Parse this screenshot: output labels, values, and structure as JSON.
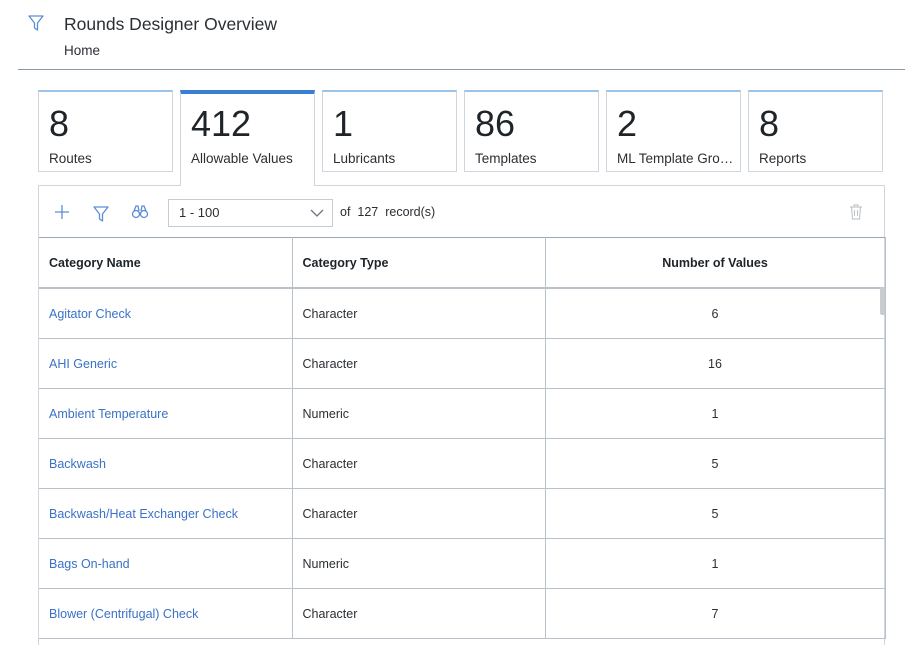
{
  "header": {
    "title": "Rounds Designer Overview",
    "breadcrumb": "Home"
  },
  "tiles": [
    {
      "count": "8",
      "label": "Routes"
    },
    {
      "count": "412",
      "label": "Allowable Values"
    },
    {
      "count": "1",
      "label": "Lubricants"
    },
    {
      "count": "86",
      "label": "Templates"
    },
    {
      "count": "2",
      "label": "ML Template Grou..."
    },
    {
      "count": "8",
      "label": "Reports"
    }
  ],
  "toolbar": {
    "range": "1 - 100",
    "of_label": "of",
    "total": "127",
    "records_label": "record(s)"
  },
  "table": {
    "columns": [
      "Category Name",
      "Category Type",
      "Number of Values"
    ],
    "rows": [
      {
        "name": "Agitator Check",
        "type": "Character",
        "count": "6"
      },
      {
        "name": "AHI Generic",
        "type": "Character",
        "count": "16"
      },
      {
        "name": "Ambient Temperature",
        "type": "Numeric",
        "count": "1"
      },
      {
        "name": "Backwash",
        "type": "Character",
        "count": "5"
      },
      {
        "name": "Backwash/Heat Exchanger Check",
        "type": "Character",
        "count": "5"
      },
      {
        "name": "Bags On-hand",
        "type": "Numeric",
        "count": "1"
      },
      {
        "name": "Blower (Centrifugal) Check",
        "type": "Character",
        "count": "7"
      }
    ]
  },
  "colors": {
    "accent": "#3a7fd5",
    "link": "#3a72c6"
  }
}
